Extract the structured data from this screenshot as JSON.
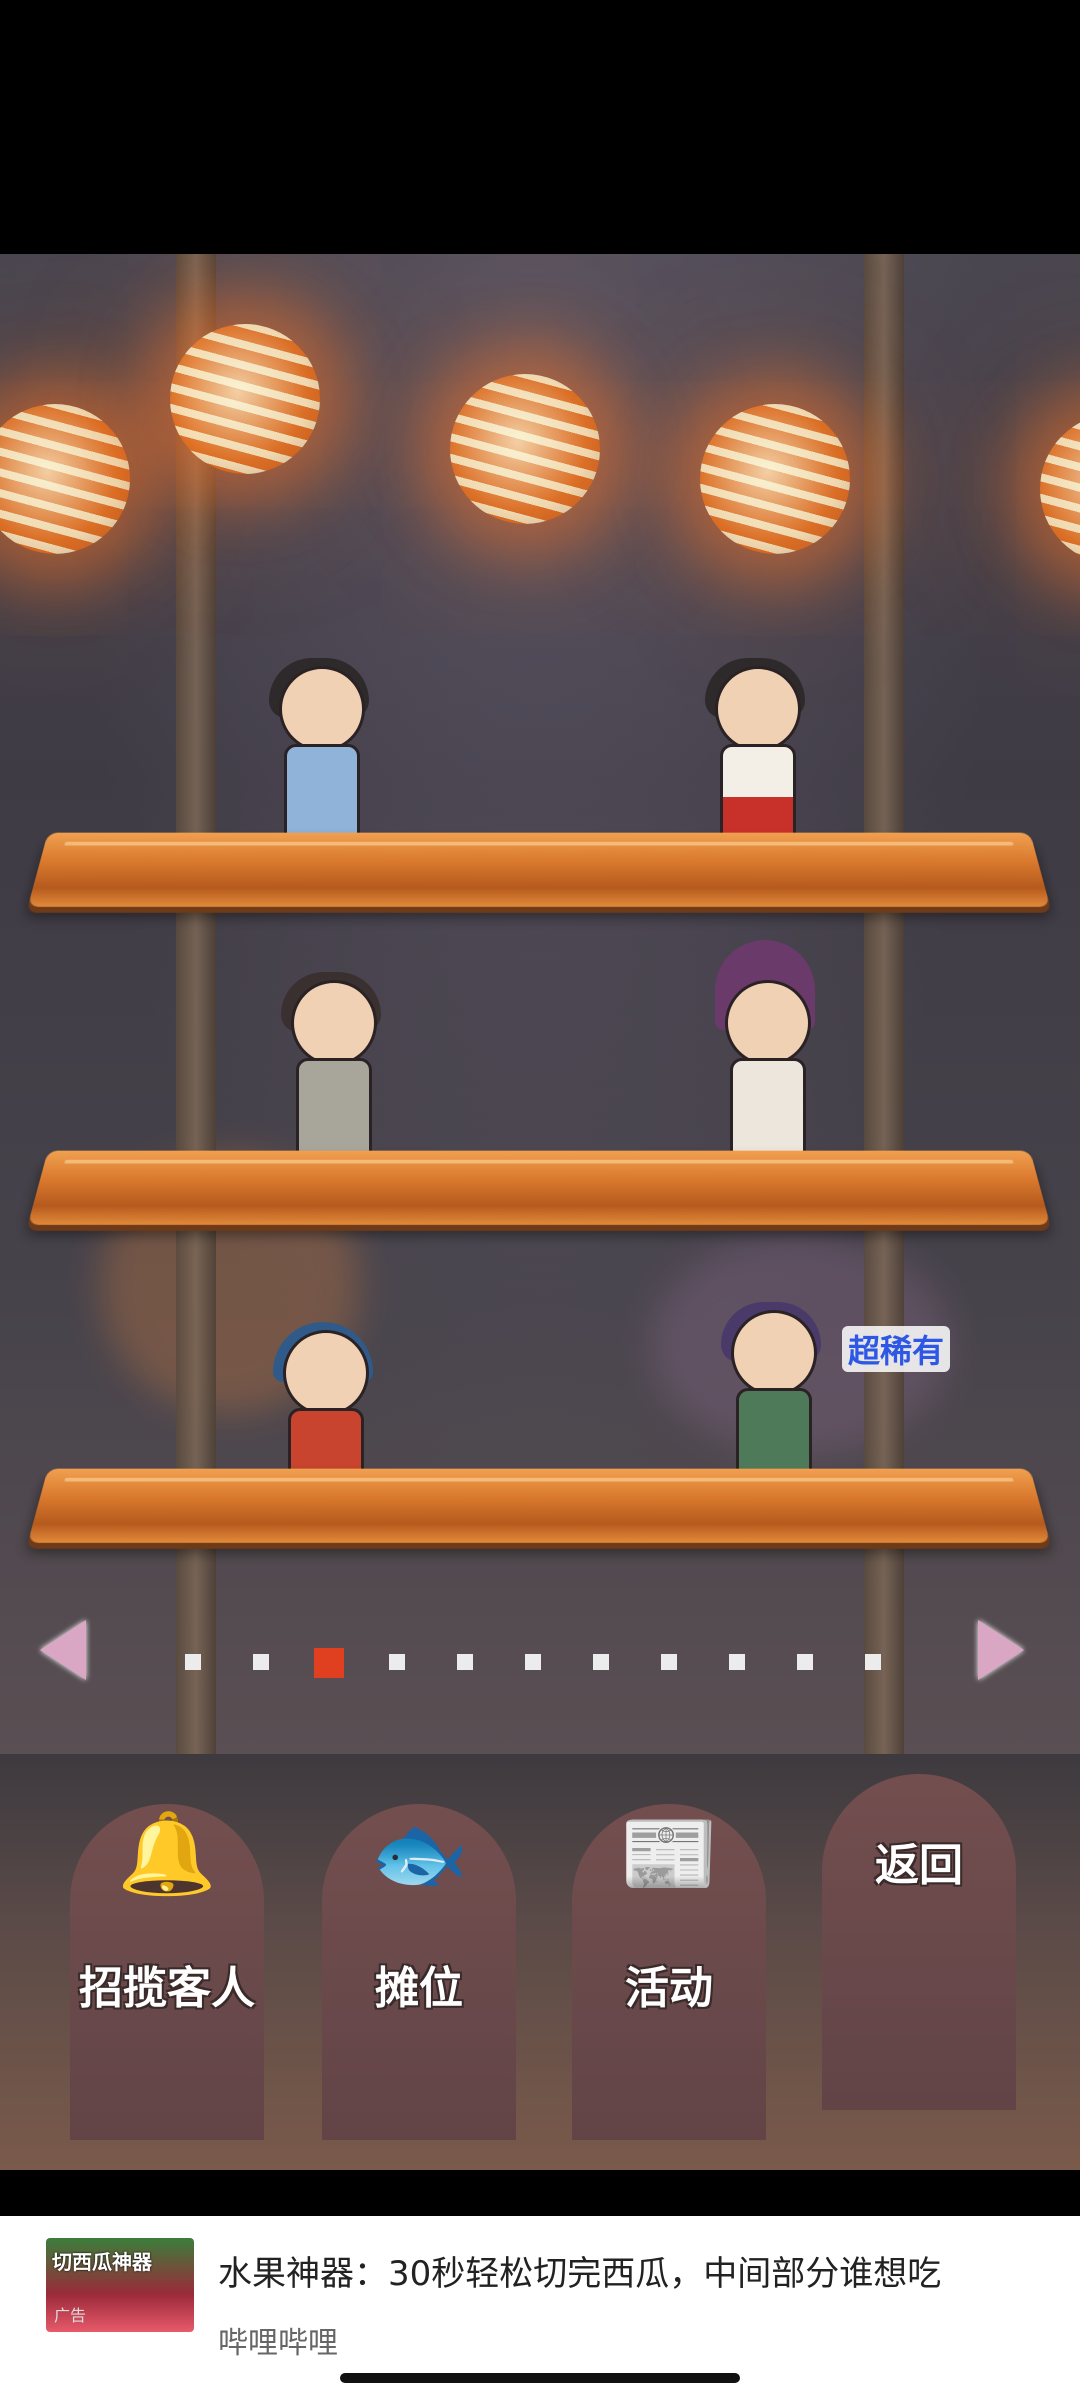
{
  "scene": {
    "rarity_label": "超稀有",
    "pager": {
      "total": 11,
      "active_index": 2
    }
  },
  "menu": {
    "items": [
      {
        "label": "招揽客人",
        "icon": "bell-icon"
      },
      {
        "label": "摊位",
        "icon": "goldfish-bag-icon"
      },
      {
        "label": "活动",
        "icon": "newspaper-icon"
      },
      {
        "label": "返回",
        "icon": ""
      }
    ]
  },
  "ad": {
    "thumb_text": "切西瓜神器",
    "thumb_tag": "广告",
    "title": "水果神器：30秒轻松切完西瓜，中间部分谁想吃",
    "source": "哔哩哔哩"
  },
  "colors": {
    "shelf": "#d9792d",
    "active_dot": "#e04020",
    "rarity_text": "#2d58e6",
    "arrow": "#d9a7c3"
  }
}
